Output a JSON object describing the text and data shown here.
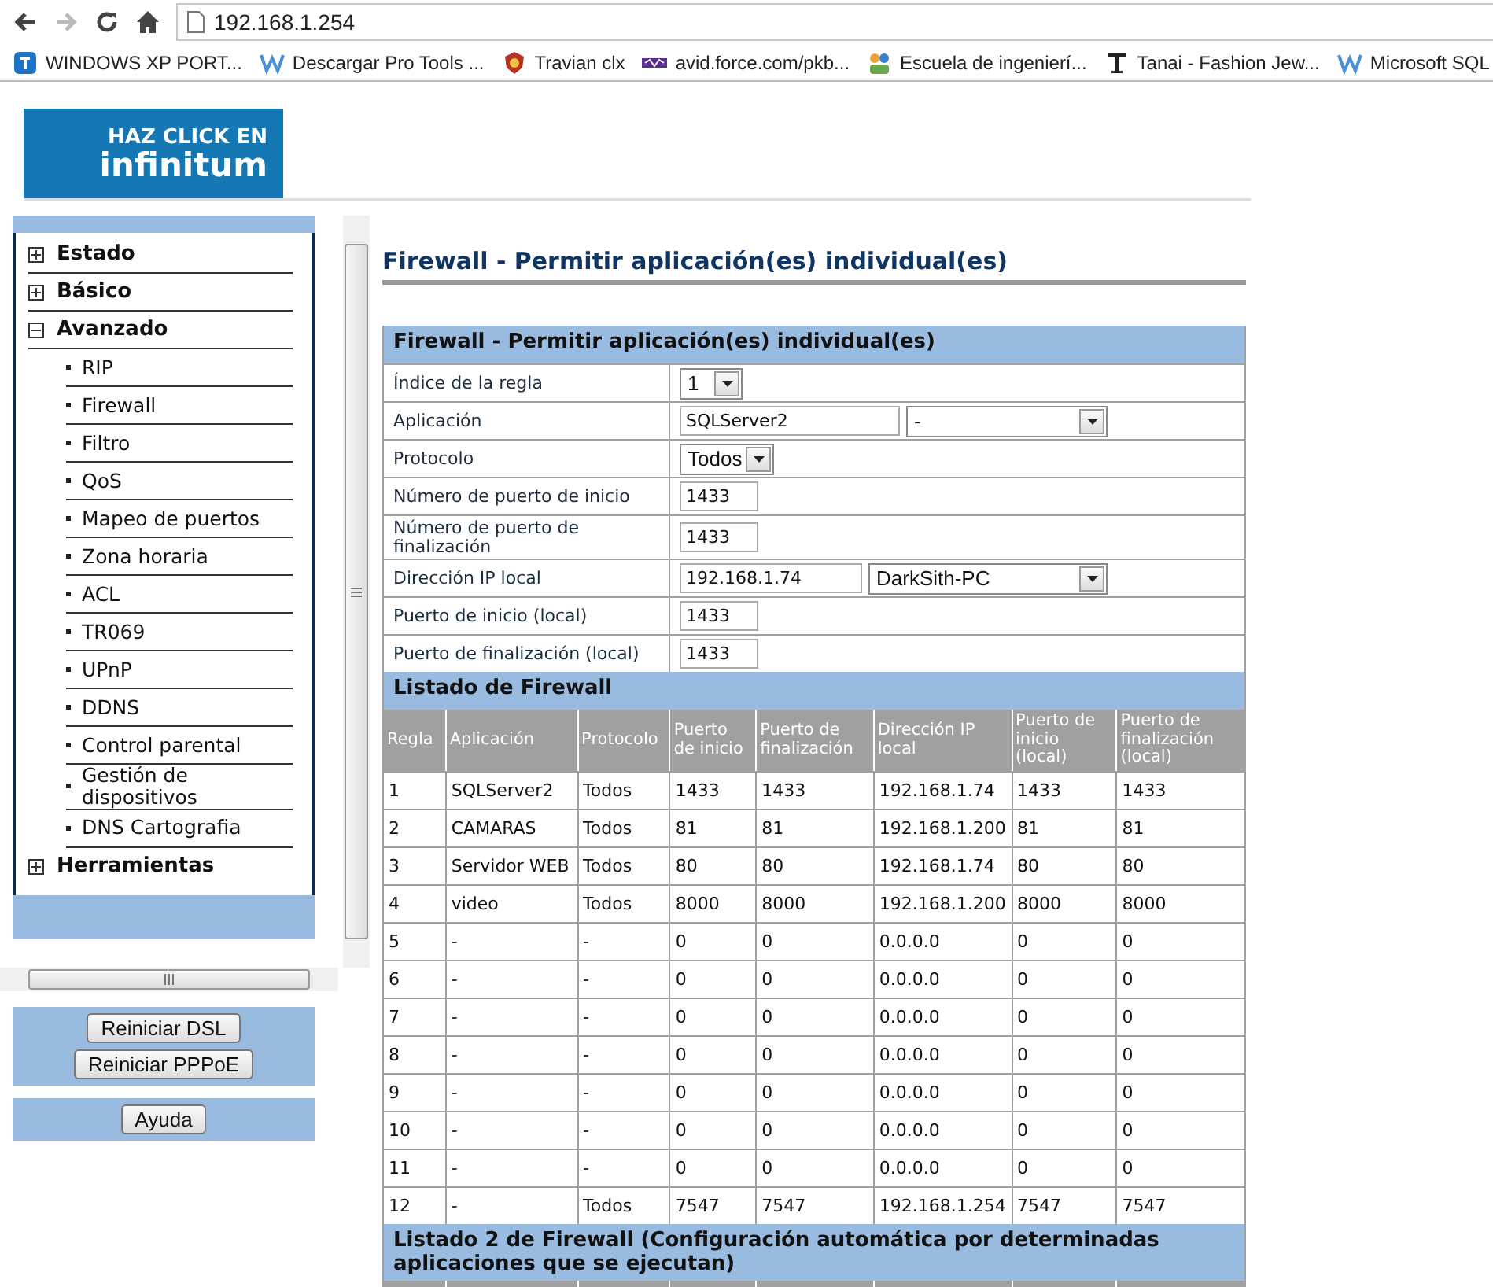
{
  "browser": {
    "address": "192.168.1.254",
    "bookmarks": [
      {
        "label": "WINDOWS XP PORT...",
        "kind": "tile"
      },
      {
        "label": "Descargar Pro Tools ...",
        "kind": "w"
      },
      {
        "label": "Travian clx",
        "kind": "shield"
      },
      {
        "label": "avid.force.com/pkb...",
        "kind": "avid"
      },
      {
        "label": "Escuela de ingenierí...",
        "kind": "people"
      },
      {
        "label": "Tanai - Fashion Jew...",
        "kind": "serif"
      },
      {
        "label": "Microsoft SQL",
        "kind": "w"
      }
    ]
  },
  "logo": {
    "line1": "HAZ CLICK EN",
    "line2": "infinitum"
  },
  "sidebar": {
    "items": [
      {
        "label": "Estado",
        "expanded": false
      },
      {
        "label": "Básico",
        "expanded": false
      },
      {
        "label": "Avanzado",
        "expanded": true,
        "children": [
          {
            "label": "RIP"
          },
          {
            "label": "Firewall"
          },
          {
            "label": "Filtro"
          },
          {
            "label": "QoS"
          },
          {
            "label": "Mapeo de puertos"
          },
          {
            "label": "Zona horaria"
          },
          {
            "label": "ACL"
          },
          {
            "label": "TR069"
          },
          {
            "label": "UPnP"
          },
          {
            "label": "DDNS"
          },
          {
            "label": "Control parental"
          },
          {
            "label": "Gestión de dispositivos"
          },
          {
            "label": "DNS Cartografia"
          }
        ]
      },
      {
        "label": "Herramientas",
        "expanded": false
      }
    ]
  },
  "actions": [
    "Reiniciar DSL",
    "Reiniciar PPPoE"
  ],
  "help_button": "Ayuda",
  "title": "Firewall - Permitir aplicación(es) individual(es)",
  "form": {
    "heading": "Firewall - Permitir aplicación(es) individual(es)",
    "rows": [
      {
        "label": "Índice de la regla",
        "kind": "select",
        "value": "1"
      },
      {
        "label": "Aplicación",
        "kind": "text_select",
        "value": "SQLServer2",
        "option": "-"
      },
      {
        "label": "Protocolo",
        "kind": "select",
        "value": "Todos"
      },
      {
        "label": "Número de puerto de inicio",
        "kind": "text",
        "value": "1433"
      },
      {
        "label": "Número de puerto de finalización",
        "kind": "text",
        "value": "1433"
      },
      {
        "label": "Dirección IP local",
        "kind": "text_select",
        "value": "192.168.1.74",
        "option": "DarkSith-PC"
      },
      {
        "label": "Puerto de inicio (local)",
        "kind": "text",
        "value": "1433"
      },
      {
        "label": "Puerto de finalización (local)",
        "kind": "text",
        "value": "1433"
      }
    ]
  },
  "listing": {
    "heading": "Listado de Firewall",
    "columns": [
      "Regla",
      "Aplicación",
      "Protocolo",
      "Puerto de inicio",
      "Puerto de finalización",
      "Dirección IP local",
      "Puerto de inicio (local)",
      "Puerto de finalización (local)"
    ],
    "rows": [
      [
        "1",
        "SQLServer2",
        "Todos",
        "1433",
        "1433",
        "192.168.1.74",
        "1433",
        "1433"
      ],
      [
        "2",
        "CAMARAS",
        "Todos",
        "81",
        "81",
        "192.168.1.200",
        "81",
        "81"
      ],
      [
        "3",
        "Servidor WEB",
        "Todos",
        "80",
        "80",
        "192.168.1.74",
        "80",
        "80"
      ],
      [
        "4",
        "video",
        "Todos",
        "8000",
        "8000",
        "192.168.1.200",
        "8000",
        "8000"
      ],
      [
        "5",
        "-",
        "-",
        "0",
        "0",
        "0.0.0.0",
        "0",
        "0"
      ],
      [
        "6",
        "-",
        "-",
        "0",
        "0",
        "0.0.0.0",
        "0",
        "0"
      ],
      [
        "7",
        "-",
        "-",
        "0",
        "0",
        "0.0.0.0",
        "0",
        "0"
      ],
      [
        "8",
        "-",
        "-",
        "0",
        "0",
        "0.0.0.0",
        "0",
        "0"
      ],
      [
        "9",
        "-",
        "-",
        "0",
        "0",
        "0.0.0.0",
        "0",
        "0"
      ],
      [
        "10",
        "-",
        "-",
        "0",
        "0",
        "0.0.0.0",
        "0",
        "0"
      ],
      [
        "11",
        "-",
        "-",
        "0",
        "0",
        "0.0.0.0",
        "0",
        "0"
      ],
      [
        "12",
        "-",
        "Todos",
        "7547",
        "7547",
        "192.168.1.254",
        "7547",
        "7547"
      ]
    ]
  },
  "listing2": {
    "heading": "Listado 2 de Firewall (Configuración automática por determinadas aplicaciones que se ejecutan)"
  }
}
